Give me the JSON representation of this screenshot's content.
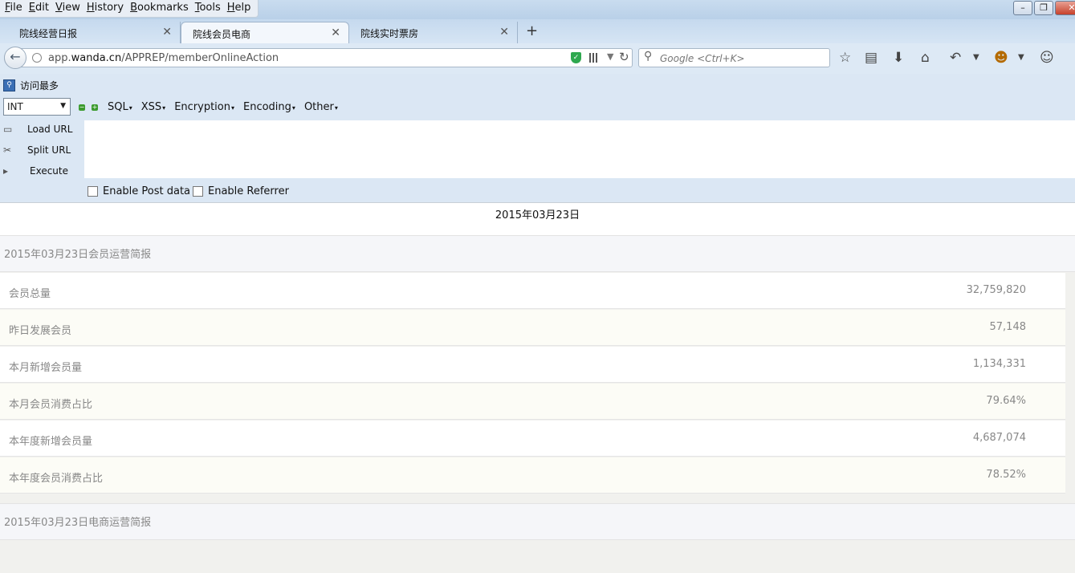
{
  "menu": [
    "File",
    "Edit",
    "View",
    "History",
    "Bookmarks",
    "Tools",
    "Help"
  ],
  "window_controls": [
    "minimize",
    "restore",
    "close"
  ],
  "tabs": [
    {
      "label": "院线经营日报",
      "active": false
    },
    {
      "label": "院线会员电商",
      "active": true
    },
    {
      "label": "院线实时票房",
      "active": false
    }
  ],
  "navbar": {
    "url_host_prefix": "app.",
    "url_host_domain": "wanda.cn",
    "url_path": "/APPREP/memberOnlineAction",
    "search_placeholder": "Google <Ctrl+K>",
    "icons": [
      "back-icon",
      "globe-icon",
      "shield-icon",
      "qr-code-icon",
      "dropdown-icon",
      "reload-icon",
      "search-icon",
      "bookmark-star-icon",
      "reading-list-icon",
      "download-icon",
      "home-icon",
      "undo-icon",
      "menu-dropdown-icon",
      "addon-face-icon",
      "menu-dropdown-icon",
      "chat-icon"
    ]
  },
  "hackbar": {
    "title": "访问最多",
    "select_value": "INT",
    "menus": [
      "SQL",
      "XSS",
      "Encryption",
      "Encoding",
      "Other"
    ],
    "buttons": [
      "Load URL",
      "Split URL",
      "Execute"
    ],
    "textarea_value": "",
    "checkboxes": [
      {
        "label": "Enable Post data",
        "checked": false
      },
      {
        "label": "Enable Referrer",
        "checked": false
      }
    ]
  },
  "report": {
    "date": "2015年03月23日",
    "member_section_title": "2015年03月23日会员运营简报",
    "rows": [
      {
        "label": "会员总量",
        "value": "32,759,820"
      },
      {
        "label": "昨日发展会员",
        "value": "57,148"
      },
      {
        "label": "本月新增会员量",
        "value": "1,134,331"
      },
      {
        "label": "本月会员消费占比",
        "value": "79.64%"
      },
      {
        "label": "本年度新增会员量",
        "value": "4,687,074"
      },
      {
        "label": "本年度会员消费占比",
        "value": "78.52%"
      }
    ],
    "ecommerce_section_title": "2015年03月23日电商运营简报"
  }
}
